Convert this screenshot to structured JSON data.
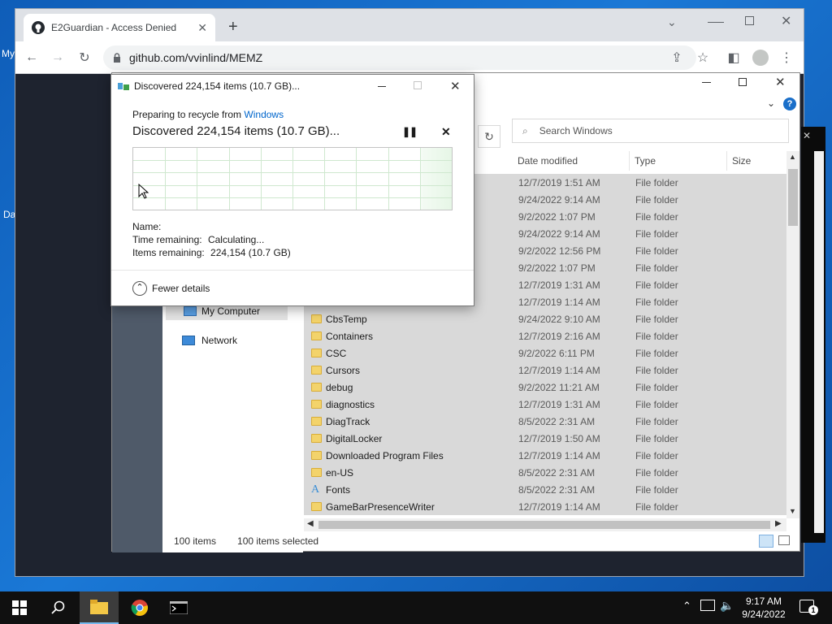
{
  "desktop": {
    "icons": [
      "My",
      "Da"
    ]
  },
  "chrome": {
    "tab_title": "E2Guardian - Access Denied",
    "new_tab": "+",
    "url": "github.com/vvinlind/MEMZ"
  },
  "explorer": {
    "search_placeholder": "Search Windows",
    "columns": [
      "Date modified",
      "Type",
      "Size"
    ],
    "nav_items": [
      "My Computer",
      "Network"
    ],
    "rows": [
      {
        "name": "",
        "date": "12/7/2019 1:51 AM",
        "type": "File folder"
      },
      {
        "name": "",
        "date": "9/24/2022 9:14 AM",
        "type": "File folder"
      },
      {
        "name": "",
        "date": "9/2/2022 1:07 PM",
        "type": "File folder"
      },
      {
        "name": "",
        "date": "9/24/2022 9:14 AM",
        "type": "File folder"
      },
      {
        "name": "",
        "date": "9/2/2022 12:56 PM",
        "type": "File folder"
      },
      {
        "name": "",
        "date": "9/2/2022 1:07 PM",
        "type": "File folder"
      },
      {
        "name": "",
        "date": "12/7/2019 1:31 AM",
        "type": "File folder"
      },
      {
        "name": "",
        "date": "12/7/2019 1:14 AM",
        "type": "File folder"
      },
      {
        "name": "CbsTemp",
        "date": "9/24/2022 9:10 AM",
        "type": "File folder"
      },
      {
        "name": "Containers",
        "date": "12/7/2019 2:16 AM",
        "type": "File folder"
      },
      {
        "name": "CSC",
        "date": "9/2/2022 6:11 PM",
        "type": "File folder"
      },
      {
        "name": "Cursors",
        "date": "12/7/2019 1:14 AM",
        "type": "File folder"
      },
      {
        "name": "debug",
        "date": "9/2/2022 11:21 AM",
        "type": "File folder"
      },
      {
        "name": "diagnostics",
        "date": "12/7/2019 1:31 AM",
        "type": "File folder"
      },
      {
        "name": "DiagTrack",
        "date": "8/5/2022 2:31 AM",
        "type": "File folder"
      },
      {
        "name": "DigitalLocker",
        "date": "12/7/2019 1:50 AM",
        "type": "File folder"
      },
      {
        "name": "Downloaded Program Files",
        "date": "12/7/2019 1:14 AM",
        "type": "File folder"
      },
      {
        "name": "en-US",
        "date": "8/5/2022 2:31 AM",
        "type": "File folder"
      },
      {
        "name": "Fonts",
        "date": "8/5/2022 2:31 AM",
        "type": "File folder",
        "icon": "fonts-folder-icon"
      },
      {
        "name": "GameBarPresenceWriter",
        "date": "12/7/2019 1:14 AM",
        "type": "File folder"
      }
    ],
    "status_count": "100 items",
    "status_selected": "100 items selected"
  },
  "dialog": {
    "title": "Discovered 224,154 items (10.7 GB)...",
    "preparing_prefix": "Preparing to recycle from",
    "preparing_link": "Windows",
    "headline": "Discovered 224,154 items (10.7 GB)...",
    "name_label": "Name:",
    "time_label": "Time remaining:",
    "time_value": "Calculating...",
    "items_label": "Items remaining:",
    "items_value": "224,154 (10.7 GB)",
    "fewer_details": "Fewer details"
  },
  "taskbar": {
    "time": "9:17 AM",
    "date": "9/24/2022",
    "notifications": "1"
  }
}
